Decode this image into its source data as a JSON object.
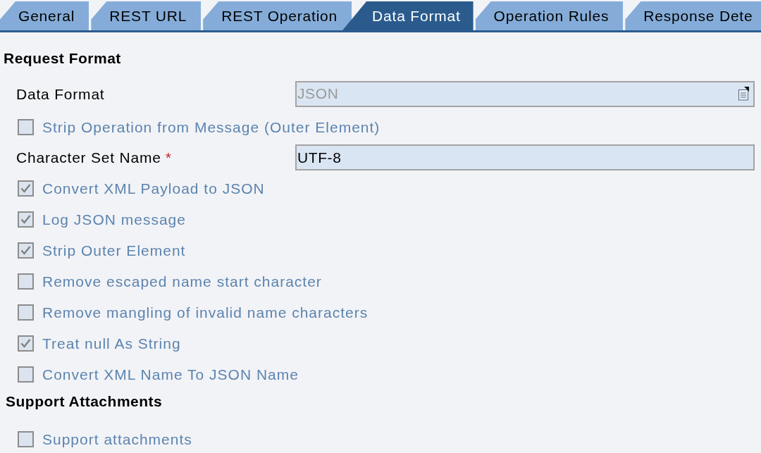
{
  "tabs": [
    {
      "label": "General",
      "selected": false
    },
    {
      "label": "REST URL",
      "selected": false
    },
    {
      "label": "REST Operation",
      "selected": false
    },
    {
      "label": "Data Format",
      "selected": true
    },
    {
      "label": "Operation Rules",
      "selected": false
    },
    {
      "label": "Response Dete",
      "selected": false
    }
  ],
  "sections": [
    {
      "title": "Request Format",
      "rows": [
        {
          "kind": "select",
          "label": "Data Format",
          "value": "JSON",
          "disabled": true
        },
        {
          "kind": "checkbox",
          "label": "Strip Operation from Message (Outer Element)",
          "checked": false
        },
        {
          "kind": "input",
          "label": "Character Set Name",
          "required_mark": "*",
          "value": "UTF-8",
          "disabled": false
        },
        {
          "kind": "checkbox",
          "label": "Convert XML Payload to JSON",
          "checked": true
        },
        {
          "kind": "checkbox",
          "label": "Log JSON message",
          "checked": true
        },
        {
          "kind": "checkbox",
          "label": "Strip Outer Element",
          "checked": true
        },
        {
          "kind": "checkbox",
          "label": "Remove escaped name start character",
          "checked": false
        },
        {
          "kind": "checkbox",
          "label": "Remove mangling of invalid name characters",
          "checked": false
        },
        {
          "kind": "checkbox",
          "label": "Treat null As String",
          "checked": true
        },
        {
          "kind": "checkbox",
          "label": "Convert XML Name To JSON Name",
          "checked": false
        }
      ]
    },
    {
      "title": "Support Attachments",
      "rows": [
        {
          "kind": "checkbox",
          "label": "Support attachments",
          "checked": false
        }
      ]
    }
  ]
}
